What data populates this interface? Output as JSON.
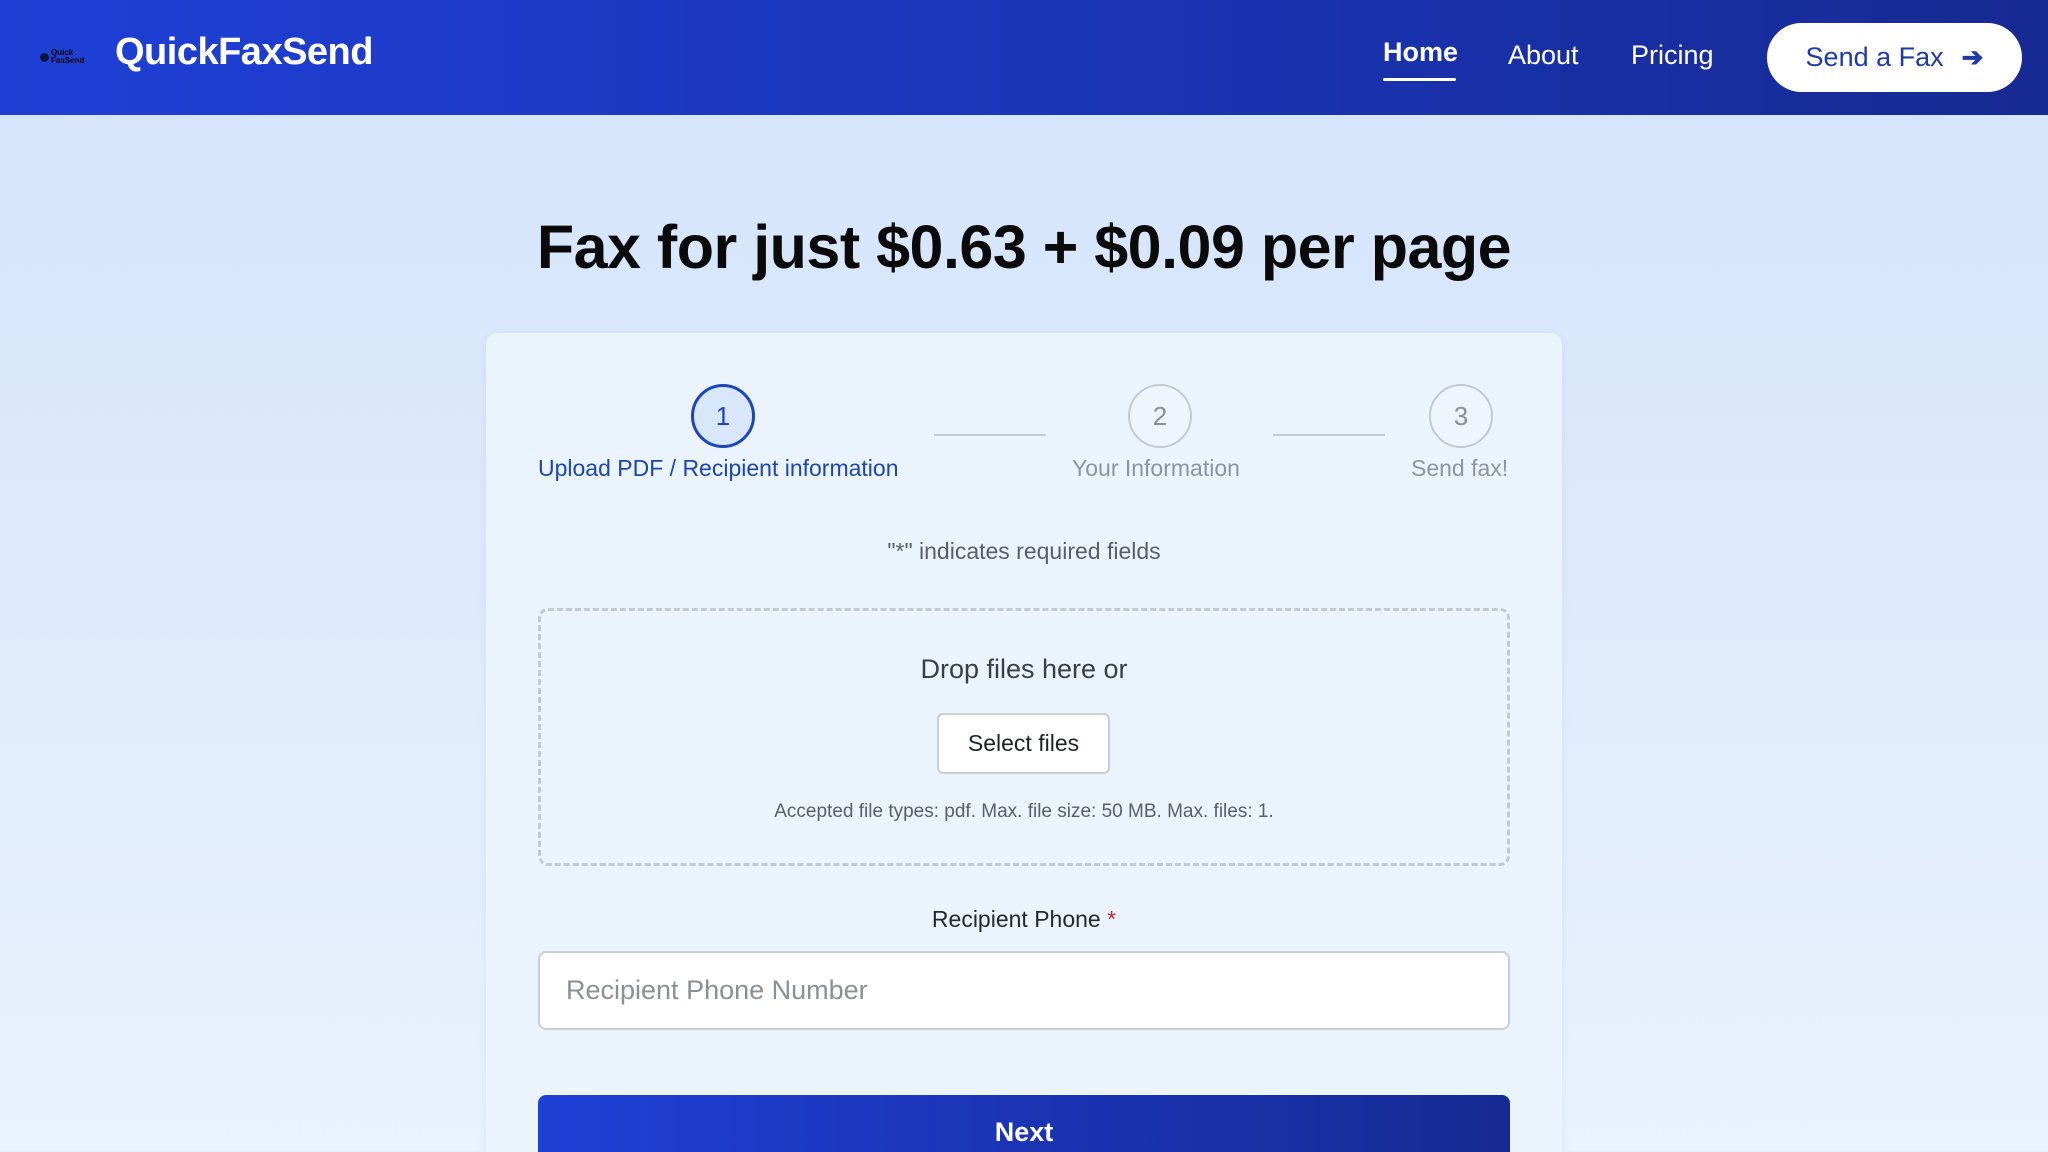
{
  "header": {
    "logo_text_line1": "Quick",
    "logo_text_line2": "FaxSend",
    "brand": "QuickFaxSend",
    "nav": {
      "home": "Home",
      "about": "About",
      "pricing": "Pricing"
    },
    "cta_label": "Send a Fax",
    "cta_icon": "arrow-right-icon"
  },
  "hero": {
    "title": "Fax for just $0.63 + $0.09 per page"
  },
  "steps": [
    {
      "number": "1",
      "label": "Upload PDF / Recipient information",
      "state": "active"
    },
    {
      "number": "2",
      "label": "Your Information",
      "state": "inactive"
    },
    {
      "number": "3",
      "label": "Send fax!",
      "state": "inactive"
    }
  ],
  "form": {
    "required_note": "\"*\" indicates required fields",
    "dropzone_text": "Drop files here or",
    "select_files_label": "Select files",
    "accepted_text": "Accepted file types: pdf. Max. file size: 50 MB. Max. files: 1.",
    "phone_label": "Recipient Phone",
    "phone_required_mark": "*",
    "phone_placeholder": "Recipient Phone Number",
    "phone_value": "",
    "next_label": "Next"
  },
  "colors": {
    "header_start": "#1f40d6",
    "header_end": "#172a93",
    "active_step": "#1d47b8",
    "required_star": "#c62828"
  }
}
